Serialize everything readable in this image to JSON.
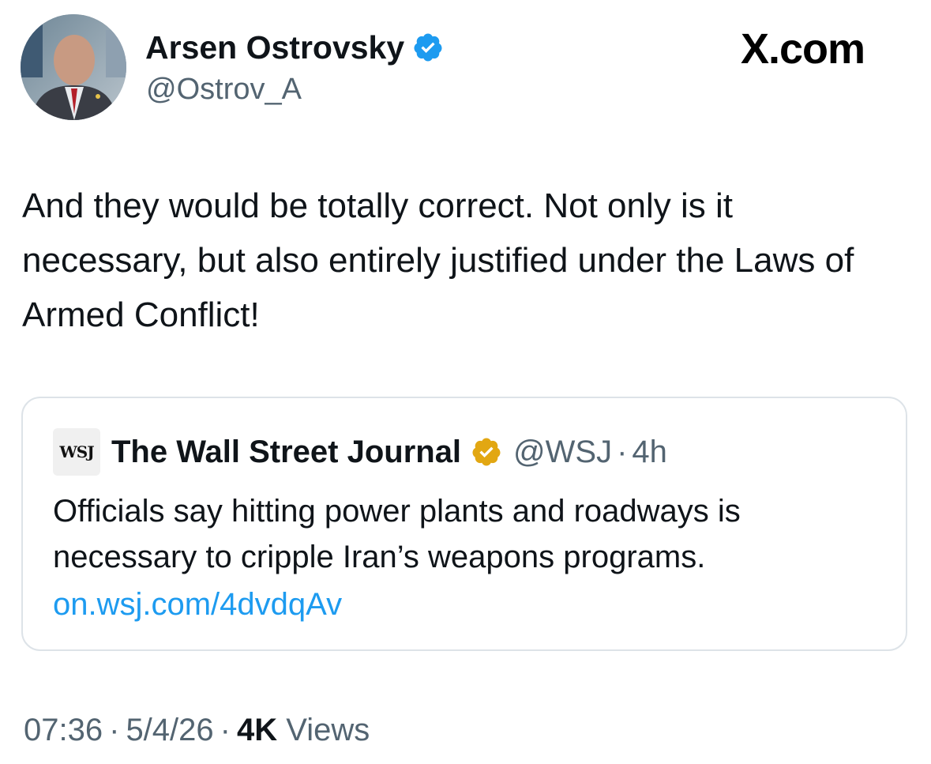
{
  "author": {
    "name": "Arsen Ostrovsky",
    "handle": "@Ostrov_A",
    "verified_color": "#1d9bf0"
  },
  "brand": "X.com",
  "tweet": {
    "text": "And they would be totally correct. Not only is it necessary, but also entirely justified under the Laws of Armed Conflict!"
  },
  "quote": {
    "logo_text": "WSJ",
    "author": "The Wall Street Journal",
    "handle": "@WSJ",
    "separator": "·",
    "time": "4h",
    "verified_color": "#e2a712",
    "text": "Officials say hitting power plants and roadways is necessary to cripple Iran’s weapons programs.",
    "link": "on.wsj.com/4dvdqAv",
    "link_color": "#1d9bf0"
  },
  "meta": {
    "time": "07:36",
    "date": "5/4/26",
    "views_count": "4K",
    "views_label": "Views",
    "separator": "·"
  },
  "icons": {
    "verified": "verified-badge-icon",
    "gold_verified": "gold-verified-badge-icon"
  }
}
